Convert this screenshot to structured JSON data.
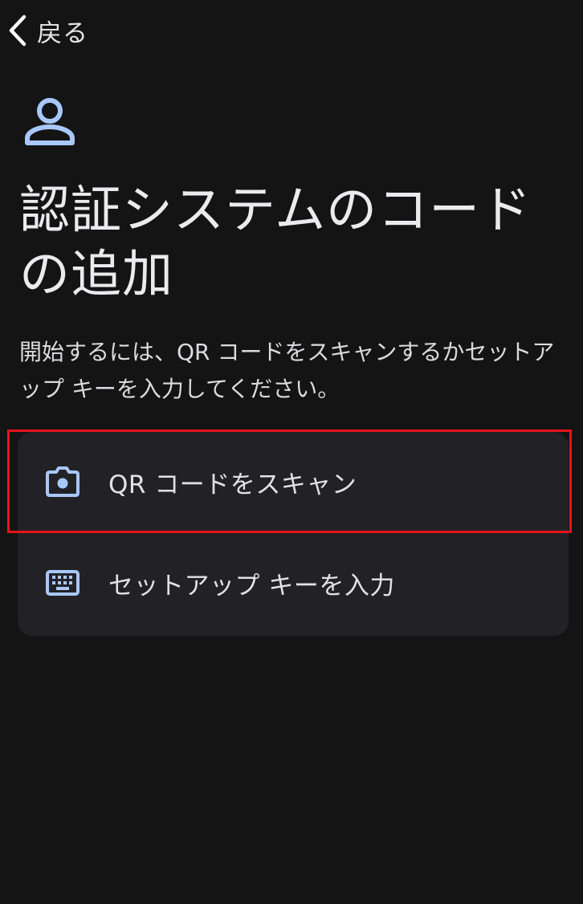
{
  "nav": {
    "back_label": "戻る"
  },
  "header": {
    "title": "認証システムのコードの追加",
    "description": "開始するには、QR コードをスキャンするかセットアップ キーを入力してください。"
  },
  "options": [
    {
      "label": "QR コードをスキャン",
      "icon": "camera-icon"
    },
    {
      "label": "セットアップ キーを入力",
      "icon": "keyboard-icon"
    }
  ],
  "colors": {
    "background": "#141415",
    "card": "#222226",
    "accent_icon": "#a8c7fa",
    "highlight_border": "#e3141c"
  }
}
